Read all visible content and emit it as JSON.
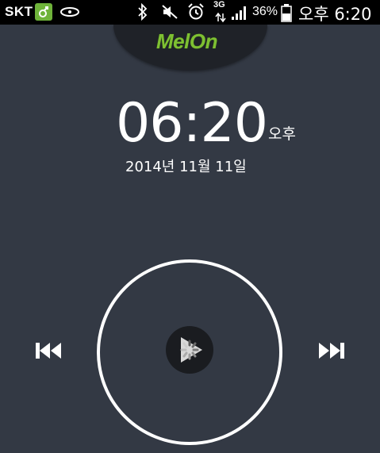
{
  "status_bar": {
    "carrier": "SKT",
    "network_type": "3G",
    "battery_percent": "36%",
    "time": "오후 6:20",
    "icons": [
      "app-badge-icon",
      "cloud-icon",
      "bluetooth-icon",
      "mute-icon",
      "alarm-icon",
      "network-arrows-icon",
      "signal-icon",
      "battery-icon"
    ]
  },
  "header": {
    "logo_text": "MelOn"
  },
  "clock": {
    "time": "06:20",
    "ampm": "오후",
    "date": "2014년 11월 11일"
  },
  "player": {
    "icons": [
      "previous-icon",
      "play-loading-icon",
      "next-icon"
    ]
  },
  "colors": {
    "background": "#333944",
    "status_bar": "#000000",
    "logo_tab": "#1f2228",
    "logo_green": "#7ec032",
    "ring": "#ffffff"
  }
}
